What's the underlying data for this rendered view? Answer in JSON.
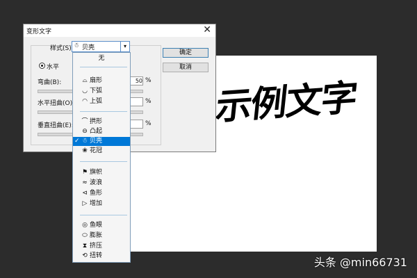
{
  "dialog": {
    "title": "变形文字",
    "close_glyph": "✕",
    "style_label": "样式(S):",
    "style_value": "贝壳",
    "style_icon": "☃",
    "orientation_label": "水平",
    "bend_label": "弯曲(B):",
    "bend_value": "50",
    "percent": "%",
    "hdist_label": "水平扭曲(O):",
    "vdist_label": "垂直扭曲(E):",
    "ok_label": "确定",
    "cancel_label": "取消"
  },
  "dropdown": {
    "none_label": "无",
    "items": [
      {
        "label": "扇形",
        "icon": "⌓"
      },
      {
        "label": "下弧",
        "icon": "◡"
      },
      {
        "label": "上弧",
        "icon": "◠"
      },
      {
        "label": "拱形",
        "icon": "⌒"
      },
      {
        "label": "凸起",
        "icon": "⊖"
      },
      {
        "label": "贝壳",
        "icon": "☃",
        "selected": true
      },
      {
        "label": "花冠",
        "icon": "❀"
      },
      {
        "label": "旗帜",
        "icon": "⚑"
      },
      {
        "label": "波浪",
        "icon": "≈"
      },
      {
        "label": "鱼形",
        "icon": "⊲"
      },
      {
        "label": "增加",
        "icon": "▷"
      },
      {
        "label": "鱼眼",
        "icon": "◎"
      },
      {
        "label": "膨胀",
        "icon": "⬭"
      },
      {
        "label": "挤压",
        "icon": "⧗"
      },
      {
        "label": "扭转",
        "icon": "⟲"
      }
    ],
    "check": "✓"
  },
  "canvas": {
    "sample_text": "示例文字"
  },
  "watermark": "头条 @min66731"
}
